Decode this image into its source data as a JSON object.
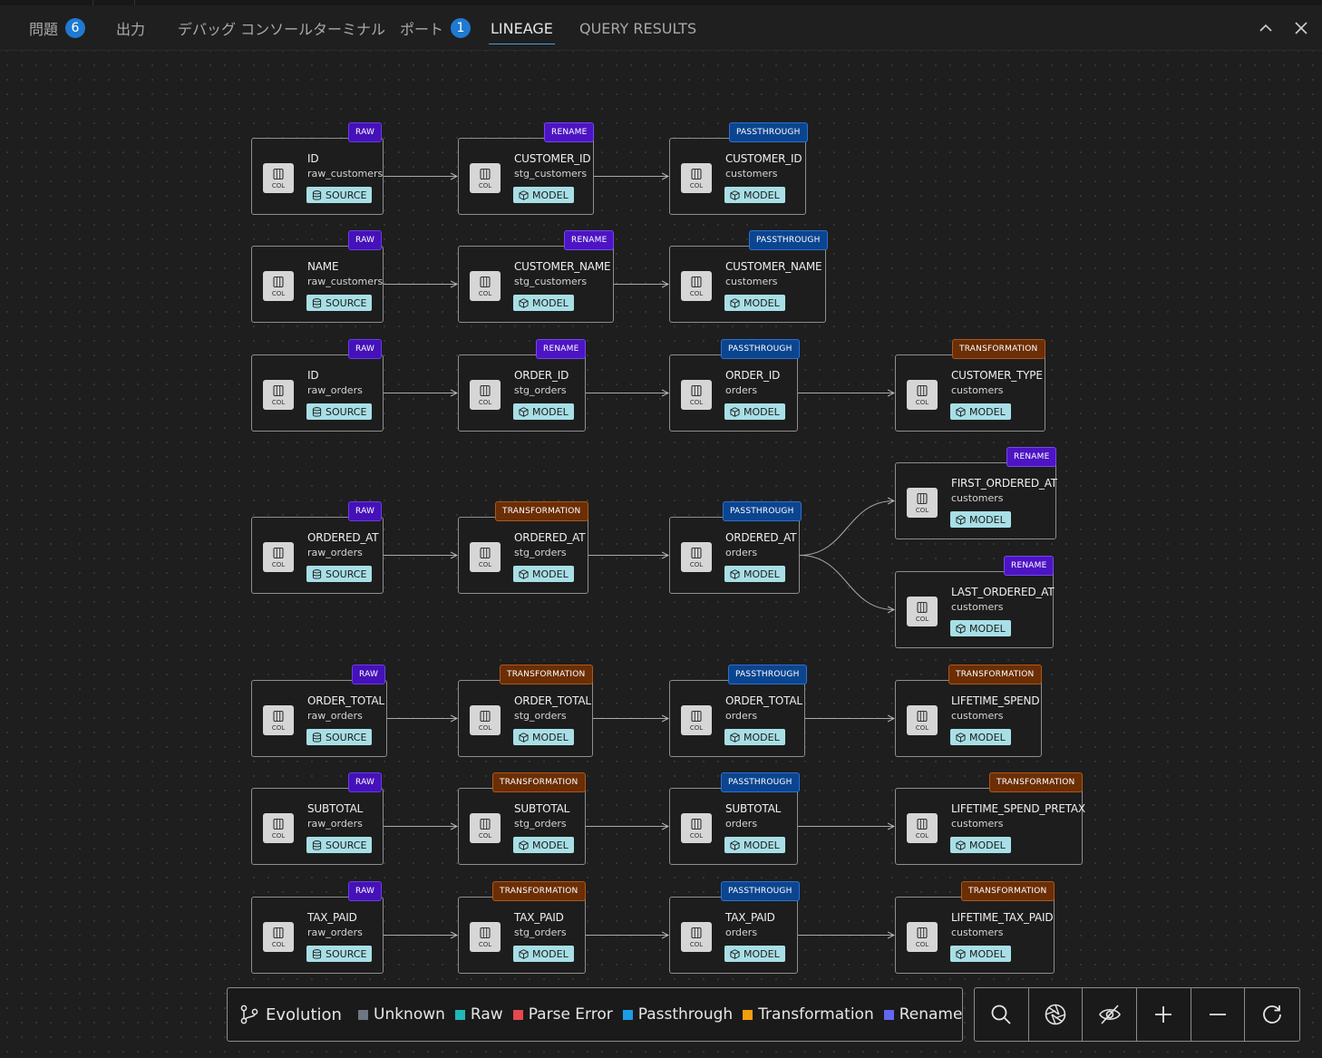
{
  "tabs": [
    {
      "label": "問題",
      "badge": "6"
    },
    {
      "label": "出力"
    },
    {
      "label": "デバッグ コンソール"
    },
    {
      "label": "ターミナル"
    },
    {
      "label": "ポート",
      "badge": "1"
    },
    {
      "label": "LINEAGE",
      "active": true
    },
    {
      "label": "QUERY RESULTS"
    }
  ],
  "window_controls": {
    "maximize_icon": "chevron-up-icon",
    "close_icon": "close-icon"
  },
  "col_label": "COL",
  "nodes": [
    {
      "id": "r1c1",
      "name": "ID",
      "table": "raw_customers",
      "type": "SOURCE",
      "tag": "RAW"
    },
    {
      "id": "r1c2",
      "name": "CUSTOMER_ID",
      "table": "stg_customers",
      "type": "MODEL",
      "tag": "RENAME"
    },
    {
      "id": "r1c3",
      "name": "CUSTOMER_ID",
      "table": "customers",
      "type": "MODEL",
      "tag": "PASSTHROUGH"
    },
    {
      "id": "r2c1",
      "name": "NAME",
      "table": "raw_customers",
      "type": "SOURCE",
      "tag": "RAW"
    },
    {
      "id": "r2c2",
      "name": "CUSTOMER_NAME",
      "table": "stg_customers",
      "type": "MODEL",
      "tag": "RENAME"
    },
    {
      "id": "r2c3",
      "name": "CUSTOMER_NAME",
      "table": "customers",
      "type": "MODEL",
      "tag": "PASSTHROUGH"
    },
    {
      "id": "r3c1",
      "name": "ID",
      "table": "raw_orders",
      "type": "SOURCE",
      "tag": "RAW"
    },
    {
      "id": "r3c2",
      "name": "ORDER_ID",
      "table": "stg_orders",
      "type": "MODEL",
      "tag": "RENAME"
    },
    {
      "id": "r3c3",
      "name": "ORDER_ID",
      "table": "orders",
      "type": "MODEL",
      "tag": "PASSTHROUGH"
    },
    {
      "id": "r3c4",
      "name": "CUSTOMER_TYPE",
      "table": "customers",
      "type": "MODEL",
      "tag": "TRANSFORMATION"
    },
    {
      "id": "r4c4",
      "name": "FIRST_ORDERED_AT",
      "table": "customers",
      "type": "MODEL",
      "tag": "RENAME"
    },
    {
      "id": "r5c1",
      "name": "ORDERED_AT",
      "table": "raw_orders",
      "type": "SOURCE",
      "tag": "RAW"
    },
    {
      "id": "r5c2",
      "name": "ORDERED_AT",
      "table": "stg_orders",
      "type": "MODEL",
      "tag": "TRANSFORMATION"
    },
    {
      "id": "r5c3",
      "name": "ORDERED_AT",
      "table": "orders",
      "type": "MODEL",
      "tag": "PASSTHROUGH"
    },
    {
      "id": "r6c4",
      "name": "LAST_ORDERED_AT",
      "table": "customers",
      "type": "MODEL",
      "tag": "RENAME"
    },
    {
      "id": "r7c1",
      "name": "ORDER_TOTAL",
      "table": "raw_orders",
      "type": "SOURCE",
      "tag": "RAW"
    },
    {
      "id": "r7c2",
      "name": "ORDER_TOTAL",
      "table": "stg_orders",
      "type": "MODEL",
      "tag": "TRANSFORMATION"
    },
    {
      "id": "r7c3",
      "name": "ORDER_TOTAL",
      "table": "orders",
      "type": "MODEL",
      "tag": "PASSTHROUGH"
    },
    {
      "id": "r7c4",
      "name": "LIFETIME_SPEND",
      "table": "customers",
      "type": "MODEL",
      "tag": "TRANSFORMATION"
    },
    {
      "id": "r8c1",
      "name": "SUBTOTAL",
      "table": "raw_orders",
      "type": "SOURCE",
      "tag": "RAW"
    },
    {
      "id": "r8c2",
      "name": "SUBTOTAL",
      "table": "stg_orders",
      "type": "MODEL",
      "tag": "TRANSFORMATION"
    },
    {
      "id": "r8c3",
      "name": "SUBTOTAL",
      "table": "orders",
      "type": "MODEL",
      "tag": "PASSTHROUGH"
    },
    {
      "id": "r8c4",
      "name": "LIFETIME_SPEND_PRETAX",
      "table": "customers",
      "type": "MODEL",
      "tag": "TRANSFORMATION"
    },
    {
      "id": "r9c1",
      "name": "TAX_PAID",
      "table": "raw_orders",
      "type": "SOURCE",
      "tag": "RAW"
    },
    {
      "id": "r9c2",
      "name": "TAX_PAID",
      "table": "stg_orders",
      "type": "MODEL",
      "tag": "TRANSFORMATION"
    },
    {
      "id": "r9c3",
      "name": "TAX_PAID",
      "table": "orders",
      "type": "MODEL",
      "tag": "PASSTHROUGH"
    },
    {
      "id": "r9c4",
      "name": "LIFETIME_TAX_PAID",
      "table": "customers",
      "type": "MODEL",
      "tag": "TRANSFORMATION"
    }
  ],
  "edges": [
    [
      "r1c1",
      "r1c2"
    ],
    [
      "r1c2",
      "r1c3"
    ],
    [
      "r2c1",
      "r2c2"
    ],
    [
      "r2c2",
      "r2c3"
    ],
    [
      "r3c1",
      "r3c2"
    ],
    [
      "r3c2",
      "r3c3"
    ],
    [
      "r3c3",
      "r3c4"
    ],
    [
      "r5c1",
      "r5c2"
    ],
    [
      "r5c2",
      "r5c3"
    ],
    [
      "r5c3",
      "r4c4"
    ],
    [
      "r5c3",
      "r6c4"
    ],
    [
      "r7c1",
      "r7c2"
    ],
    [
      "r7c2",
      "r7c3"
    ],
    [
      "r7c3",
      "r7c4"
    ],
    [
      "r8c1",
      "r8c2"
    ],
    [
      "r8c2",
      "r8c3"
    ],
    [
      "r8c3",
      "r8c4"
    ],
    [
      "r9c1",
      "r9c2"
    ],
    [
      "r9c2",
      "r9c3"
    ],
    [
      "r9c3",
      "r9c4"
    ]
  ],
  "legend": {
    "title": "Evolution",
    "icon": "git-branch-icon",
    "items": [
      {
        "label": "Unknown",
        "color": "#6e7681"
      },
      {
        "label": "Raw",
        "color": "#20b8b8"
      },
      {
        "label": "Parse Error",
        "color": "#e5484d"
      },
      {
        "label": "Passthrough",
        "color": "#1c9be6"
      },
      {
        "label": "Transformation",
        "color": "#f59e0b"
      },
      {
        "label": "Rename",
        "color": "#6366f1"
      }
    ]
  },
  "controls": [
    {
      "name": "search-button",
      "icon": "search-icon"
    },
    {
      "name": "focus-button",
      "icon": "aperture-icon"
    },
    {
      "name": "hide-button",
      "icon": "eye-off-icon"
    },
    {
      "name": "zoom-in-button",
      "icon": "plus-icon"
    },
    {
      "name": "zoom-out-button",
      "icon": "minus-icon"
    },
    {
      "name": "refresh-button",
      "icon": "refresh-icon"
    }
  ]
}
